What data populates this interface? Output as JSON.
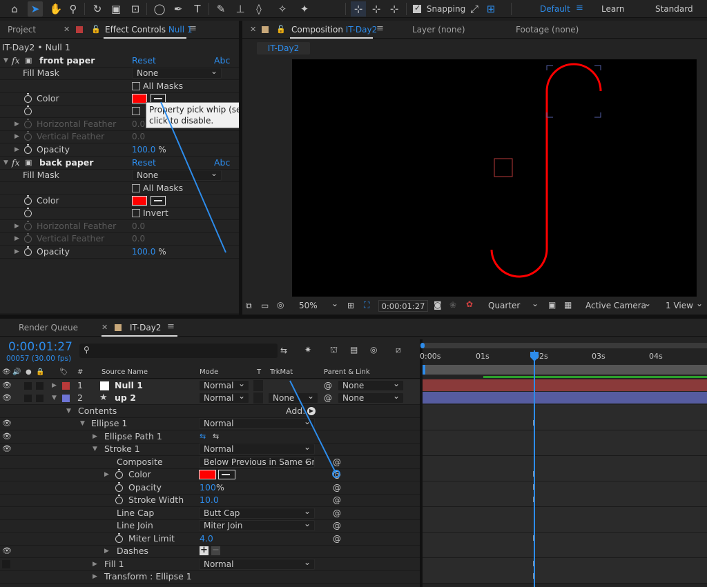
{
  "toolbar": {
    "snapping_label": "Snapping",
    "workspaces": [
      "Default",
      "Learn",
      "Standard"
    ]
  },
  "effect_panel": {
    "project_tab": "Project",
    "effect_controls_tab": "Effect Controls",
    "effect_controls_target": "Null 1",
    "breadcrumb": "IT-Day2 • Null 1",
    "effects": [
      {
        "name": "front paper",
        "reset": "Reset",
        "about": "Abc",
        "fill_mask_label": "Fill Mask",
        "fill_mask_value": "None",
        "all_masks_label": "All Masks",
        "color_label": "Color",
        "horizontal_feather_label": "Horizontal Feather",
        "horizontal_feather_value": "0.0",
        "vertical_feather_label": "Vertical Feather",
        "vertical_feather_value": "0.0",
        "opacity_label": "Opacity",
        "opacity_value": "100.0",
        "opacity_unit": "%"
      },
      {
        "name": "back paper",
        "reset": "Reset",
        "about": "Abc",
        "fill_mask_label": "Fill Mask",
        "fill_mask_value": "None",
        "all_masks_label": "All Masks",
        "color_label": "Color",
        "invert_label": "Invert",
        "horizontal_feather_label": "Horizontal Feather",
        "horizontal_feather_value": "0.0",
        "vertical_feather_label": "Vertical Feather",
        "vertical_feather_value": "0.0",
        "opacity_label": "Opacity",
        "opacity_value": "100.0",
        "opacity_unit": "%"
      }
    ],
    "tooltip": "Property pick whip (select property from which to inherit value). Alt-click to disable.",
    "accent_color": "#ff0000"
  },
  "comp_panel": {
    "composition_tab": "Composition",
    "composition_name": "IT-Day2",
    "layer_tab": "Layer (none)",
    "footage_tab": "Footage (none)",
    "sub_tab": "IT-Day2",
    "zoom": "50%",
    "timecode": "0:00:01:27",
    "resolution": "Quarter",
    "camera": "Active Camera",
    "views": "1 View"
  },
  "timeline": {
    "render_queue_tab": "Render Queue",
    "comp_tab": "IT-Day2",
    "timecode": "0:00:01:27",
    "frames": "00057 (30.00 fps)",
    "columns": {
      "num": "#",
      "source_name": "Source Name",
      "mode": "Mode",
      "t": "T",
      "trkmat": "TrkMat",
      "parent": "Parent & Link"
    },
    "ruler": [
      "0:00s",
      "01s",
      "02s",
      "03s",
      "04s"
    ],
    "layers": [
      {
        "num": "1",
        "name": "Null 1",
        "mode": "Normal",
        "parent": "None",
        "label_color": "#b83a3a"
      },
      {
        "num": "2",
        "name": "up 2",
        "mode": "Normal",
        "trkmat": "None",
        "parent": "None",
        "label_color": "#6e75d6"
      }
    ],
    "props": {
      "contents": "Contents",
      "add": "Add:",
      "ellipse1": "Ellipse 1",
      "ellipse1_mode": "Normal",
      "ellipse_path": "Ellipse Path 1",
      "stroke1": "Stroke 1",
      "stroke1_mode": "Normal",
      "composite": "Composite",
      "composite_value": "Below Previous in Same Gr",
      "color": "Color",
      "opacity": "Opacity",
      "opacity_value": "100",
      "opacity_unit": "%",
      "stroke_width": "Stroke Width",
      "stroke_width_value": "10.0",
      "line_cap": "Line Cap",
      "line_cap_value": "Butt Cap",
      "line_join": "Line Join",
      "line_join_value": "Miter Join",
      "miter_limit": "Miter Limit",
      "miter_limit_value": "4.0",
      "dashes": "Dashes",
      "fill1": "Fill 1",
      "fill1_mode": "Normal",
      "transform": "Transform : Ellipse 1"
    }
  }
}
